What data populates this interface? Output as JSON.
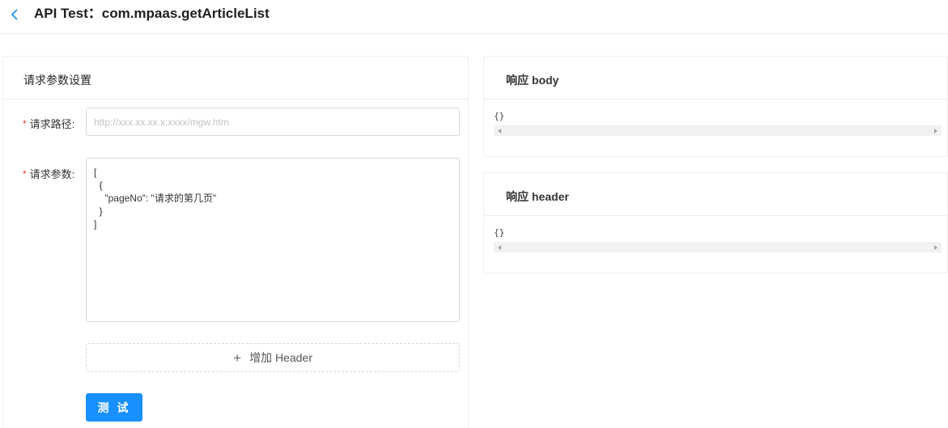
{
  "header": {
    "title": "API Test：com.mpaas.getArticleList"
  },
  "request_panel": {
    "title": "请求参数设置",
    "required_mark": "*",
    "url_label": "请求路径:",
    "url_value": "",
    "url_placeholder": "http://xxx.xx.xx.x:xxxx/mgw.htm",
    "params_label": "请求参数:",
    "params_value": "[\n  {\n    \"pageNo\": \"请求的第几页\"\n  }\n]",
    "add_header_label": "增加 Header",
    "test_button_label": "测 试"
  },
  "response_body": {
    "title": "响应 body",
    "content": "{}"
  },
  "response_header": {
    "title": "响应 header",
    "content": "{}"
  },
  "icons": {
    "back": "chevron-left-icon",
    "add": "plus-icon",
    "scroll_left": "scroll-left-arrow-icon",
    "scroll_right": "scroll-right-arrow-icon"
  },
  "colors": {
    "primary": "#1890ff",
    "required": "#e8412b",
    "back_icon": "#1890ff"
  }
}
